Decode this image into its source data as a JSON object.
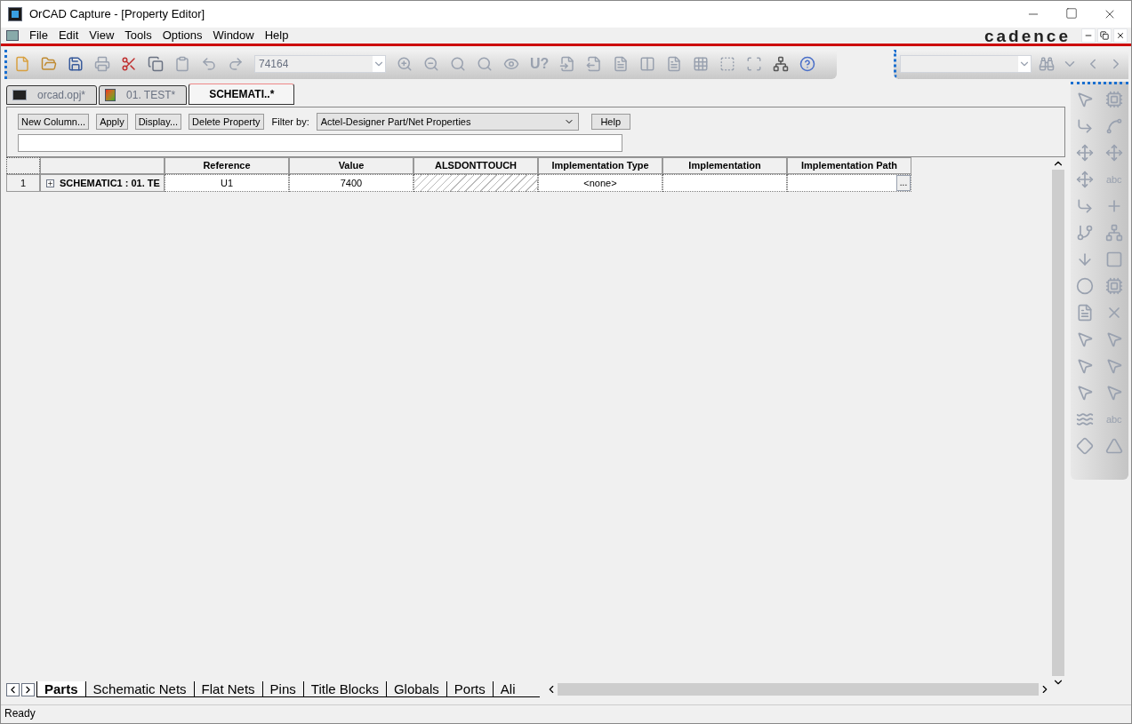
{
  "window": {
    "title": "OrCAD Capture - [Property Editor]"
  },
  "menu": [
    "File",
    "Edit",
    "View",
    "Tools",
    "Options",
    "Window",
    "Help"
  ],
  "logo": "cadence",
  "toolbar": {
    "part_combo": "74164",
    "part_label": "U?"
  },
  "doc_tabs": [
    {
      "label": "orcad.opj*",
      "selected": false,
      "kind": "project"
    },
    {
      "label": "01. TEST*",
      "selected": false,
      "kind": "page"
    },
    {
      "label": "SCHEMATI..*",
      "selected": true,
      "kind": "editor"
    }
  ],
  "editor": {
    "buttons": [
      "New Column...",
      "Apply",
      "Display...",
      "Delete Property"
    ],
    "filter_label": "Filter by:",
    "filter_value": "Actel-Designer Part/Net Properties",
    "help": "Help"
  },
  "table": {
    "columns": [
      "Reference",
      "Value",
      "ALSDONTTOUCH",
      "Implementation Type",
      "Implementation",
      "Implementation Path"
    ],
    "rows": [
      {
        "number": "1",
        "name": "SCHEMATIC1 : 01. TE",
        "expanded": false,
        "cells": [
          {
            "kind": "text",
            "text": "U1"
          },
          {
            "kind": "text",
            "text": "7400"
          },
          {
            "kind": "hatched"
          },
          {
            "kind": "text",
            "text": "<none>"
          },
          {
            "kind": "empty"
          },
          {
            "kind": "browse",
            "text": "..."
          }
        ]
      }
    ]
  },
  "sheet_tabs": [
    {
      "label": "Parts",
      "selected": true
    },
    {
      "label": "Schematic Nets",
      "selected": false
    },
    {
      "label": "Flat Nets",
      "selected": false
    },
    {
      "label": "Pins",
      "selected": false
    },
    {
      "label": "Title Blocks",
      "selected": false
    },
    {
      "label": "Globals",
      "selected": false
    },
    {
      "label": "Ports",
      "selected": false
    },
    {
      "label": "Ali",
      "selected": false
    }
  ],
  "palette_labels": [
    "abc",
    "abc"
  ],
  "status_bar": "Ready"
}
